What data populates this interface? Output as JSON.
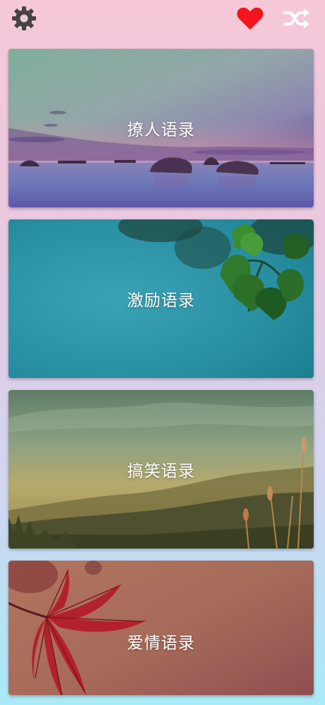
{
  "header": {
    "settings_icon": "gear-icon",
    "favorites_icon": "heart-icon",
    "shuffle_icon": "shuffle-icon",
    "colors": {
      "gear": "#444444",
      "heart": "#f2141e",
      "shuffle": "#ffffff"
    }
  },
  "categories": [
    {
      "title": "撩人语录"
    },
    {
      "title": "激励语录"
    },
    {
      "title": "搞笑语录"
    },
    {
      "title": "爱情语录"
    }
  ]
}
